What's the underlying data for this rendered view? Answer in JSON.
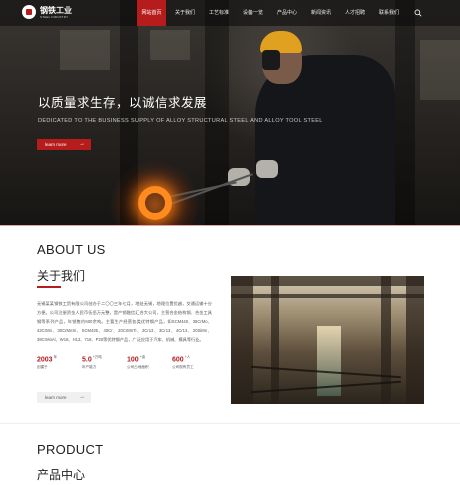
{
  "brand": {
    "name_cn": "钢铁工业",
    "name_en": "STEEL INDUSTRY"
  },
  "nav": {
    "items": [
      {
        "label": "网站首页"
      },
      {
        "label": "关于我们"
      },
      {
        "label": "工艺标准"
      },
      {
        "label": "设备一览"
      },
      {
        "label": "产品中心"
      },
      {
        "label": "新闻资讯"
      },
      {
        "label": "人才招聘"
      },
      {
        "label": "联系我们"
      }
    ],
    "active_index": 0,
    "search_icon": "search-icon"
  },
  "hero": {
    "title": "以质量求生存，以诚信求发展",
    "subtitle": "DEDICATED TO THE BUSINESS SUPPLY OF ALLOY STRUCTURAL STEEL AND ALLOY TOOL STEEL",
    "button_label": "learn more",
    "button_icon": "arrow-right-icon"
  },
  "about": {
    "title_en": "ABOUT US",
    "title_cn": "关于我们",
    "paragraph": "无锡某某钢铁工贸有限公司创办于二〇〇三年七月，地处无锡，地理位置优越，交通运输十分方便。公司注册资金人民币伍佰万元整，是产销融信汇合大公司，主营合金结构钢、合金工具钢等系列产品，年销售约600余吨。主要生产经营各类优特钢产品，如SCM440、35CrMo、42CrMo、30CrMnSi、SCM435、40Cr、20CrMnTi、2Cr13、3Cr13、4Cr13、20SiMn、38CrMoAl、W18、H13、718、P20等优特钢产品，广泛应用于汽车、机械、模具等行业。",
    "stats": [
      {
        "value": "2003",
        "unit": "年",
        "label": "创建于"
      },
      {
        "value": "5.0",
        "unit": "+万吨",
        "label": "年产能力"
      },
      {
        "value": "100",
        "unit": "+亩",
        "label": "公司占地面积"
      },
      {
        "value": "600",
        "unit": "+人",
        "label": "公司现有员工"
      }
    ],
    "button_label": "learn more",
    "button_icon": "arrow-right-icon"
  },
  "product": {
    "title_en": "PRODUCT",
    "title_cn": "产品中心"
  },
  "colors": {
    "accent": "#b71c1c",
    "nav_bg": "#1a1a1a"
  }
}
